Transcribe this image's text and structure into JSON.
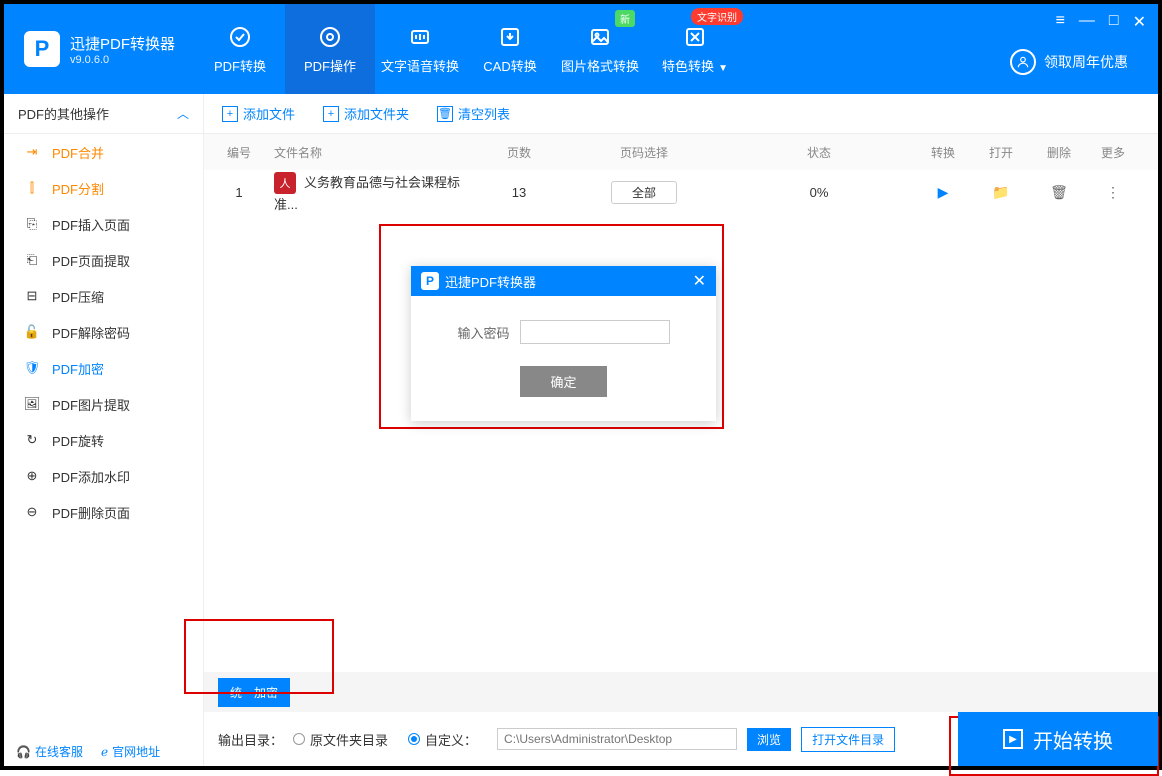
{
  "app": {
    "name": "迅捷PDF转换器",
    "version": "v9.0.6.0"
  },
  "tabs": [
    {
      "label": "PDF转换"
    },
    {
      "label": "PDF操作"
    },
    {
      "label": "文字语音转换"
    },
    {
      "label": "CAD转换"
    },
    {
      "label": "图片格式转换",
      "badge_new": "新"
    },
    {
      "label": "特色转换",
      "badge_red": "文字识别"
    }
  ],
  "promo": "领取周年优惠",
  "toolbar": {
    "add_file": "添加文件",
    "add_folder": "添加文件夹",
    "clear": "清空列表"
  },
  "sidebar": {
    "header": "PDF的其他操作",
    "items": [
      {
        "label": "PDF合并"
      },
      {
        "label": "PDF分割"
      },
      {
        "label": "PDF插入页面"
      },
      {
        "label": "PDF页面提取"
      },
      {
        "label": "PDF压缩"
      },
      {
        "label": "PDF解除密码"
      },
      {
        "label": "PDF加密"
      },
      {
        "label": "PDF图片提取"
      },
      {
        "label": "PDF旋转"
      },
      {
        "label": "PDF添加水印"
      },
      {
        "label": "PDF删除页面"
      }
    ]
  },
  "table": {
    "headers": {
      "num": "编号",
      "name": "文件名称",
      "pages": "页数",
      "select": "页码选择",
      "status": "状态",
      "convert": "转换",
      "open": "打开",
      "del": "删除",
      "more": "更多"
    },
    "rows": [
      {
        "num": "1",
        "name": "义务教育品德与社会课程标准...",
        "pages": "13",
        "select": "全部",
        "status": "0%"
      }
    ]
  },
  "dialog": {
    "title": "迅捷PDF转换器",
    "input_label": "输入密码",
    "ok": "确定"
  },
  "options": {
    "unify": "统一加密"
  },
  "footer": {
    "output_label": "输出目录：",
    "radio_original": "原文件夹目录",
    "radio_custom": "自定义：",
    "path_placeholder": "C:\\Users\\Administrator\\Desktop",
    "browse": "浏览",
    "open_dir": "打开文件目录",
    "start": "开始转换"
  },
  "footer_links": {
    "service": "在线客服",
    "site": "官网地址"
  }
}
